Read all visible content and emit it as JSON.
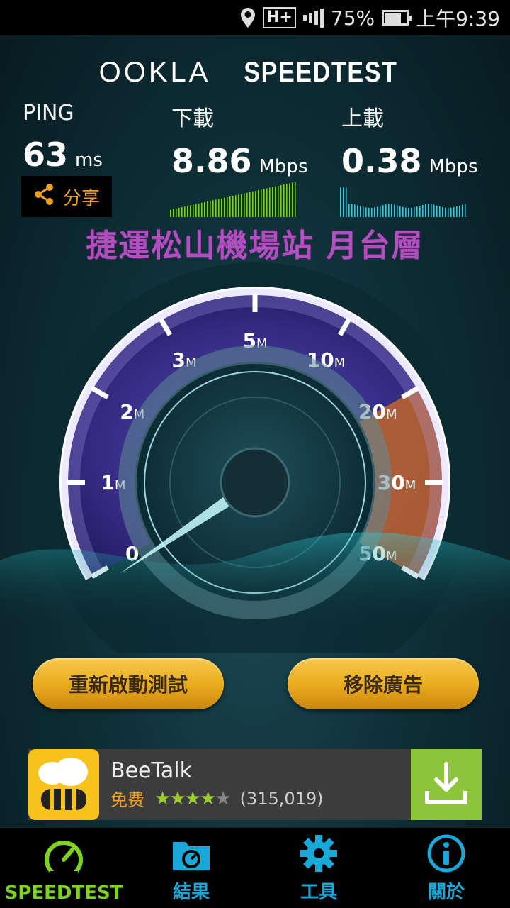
{
  "status_bar": {
    "network": "H+",
    "battery": "75%",
    "time": "上午9:39",
    "icons": [
      "location-icon",
      "network-type-icon",
      "signal-icon",
      "battery-icon"
    ]
  },
  "logo": {
    "brand": "OOKLA",
    "product": "SPEEDTEST"
  },
  "stats": {
    "ping": {
      "label": "PING",
      "value": "63",
      "unit": "ms"
    },
    "download": {
      "label": "下載",
      "value": "8.86",
      "unit": "Mbps"
    },
    "upload": {
      "label": "上載",
      "value": "0.38",
      "unit": "Mbps"
    }
  },
  "share": {
    "label": "分享",
    "icon": "share-icon"
  },
  "location_label": "捷運松山機場站 月台層",
  "gauge": {
    "ticks": [
      {
        "num": "0",
        "unit": ""
      },
      {
        "num": "1",
        "unit": "M"
      },
      {
        "num": "2",
        "unit": "M"
      },
      {
        "num": "3",
        "unit": "M"
      },
      {
        "num": "5",
        "unit": "M"
      },
      {
        "num": "10",
        "unit": "M"
      },
      {
        "num": "20",
        "unit": "M"
      },
      {
        "num": "30",
        "unit": "M"
      },
      {
        "num": "50",
        "unit": "M"
      }
    ],
    "needle_reading": "0",
    "colors": {
      "track": "#3b2f8a",
      "high_zone": "#e07a2a",
      "needle": "#9fe8f0"
    }
  },
  "buttons": {
    "restart": "重新啟動測試",
    "remove_ads": "移除廣告"
  },
  "ad": {
    "title": "BeeTalk",
    "price": "免费",
    "rating": 4,
    "max_rating": 5,
    "reviews": "(315,019)",
    "icon": "beetalk-app-icon",
    "action_icon": "download-icon"
  },
  "nav": {
    "items": [
      {
        "label": "SPEEDTEST",
        "icon": "speedometer-icon",
        "active": true
      },
      {
        "label": "結果",
        "icon": "results-folder-icon",
        "active": false
      },
      {
        "label": "工具",
        "icon": "gear-icon",
        "active": false
      },
      {
        "label": "關於",
        "icon": "info-icon",
        "active": false
      }
    ]
  },
  "colors": {
    "accent": "#f0a020",
    "nav_active": "#7ed321",
    "nav_inactive": "#19a9d9",
    "location_text": "#b24fc0"
  }
}
